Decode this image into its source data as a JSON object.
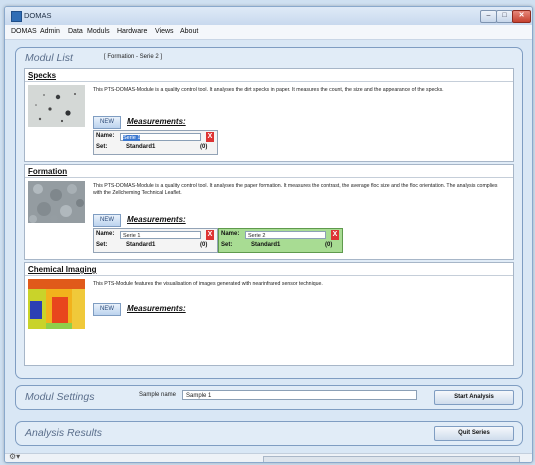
{
  "window": {
    "title": "DOMAS",
    "min_glyph": "–",
    "max_glyph": "□",
    "close_glyph": "✕"
  },
  "menu": [
    "DOMAS",
    "Admin",
    "Data",
    "Moduls",
    "Hardware",
    "Views",
    "About"
  ],
  "modul_list": {
    "title": "Modul List",
    "selection": "[ Formation - Serie 2 ]",
    "sections": {
      "specks": {
        "title": "Specks",
        "description": "This PTS-DOMAS-Module is a quality control tool. It analyses the dirt specks in paper. It measures the count, the size and the appearance of the specks.",
        "new_label": "NEW",
        "measurements_label": "Measurements:",
        "sets": [
          {
            "name_label": "Name:",
            "name_value": "Serie 1",
            "set_label": "Set:",
            "set_value": "Standard1",
            "count": "(0)",
            "close": "X"
          }
        ]
      },
      "formation": {
        "title": "Formation",
        "description": "This PTS-DOMAS-Module is a quality control tool. It analyses the paper formation. It measures the contrast, the average floc size and the floc orientation. The analysis complies with the Zellcheming Technical Leaflet.",
        "new_label": "NEW",
        "measurements_label": "Measurements:",
        "sets": [
          {
            "name_label": "Name:",
            "name_value": "Serie 1",
            "set_label": "Set:",
            "set_value": "Standard1",
            "count": "(0)",
            "close": "X"
          },
          {
            "name_label": "Name:",
            "name_value": "Serie 2",
            "set_label": "Set:",
            "set_value": "Standard1",
            "count": "(0)",
            "close": "X"
          }
        ]
      },
      "chemical": {
        "title": "Chemical Imaging",
        "description": "This PTS-Module features the visualisation of images generated with nearinfrared sensor technique.",
        "new_label": "NEW",
        "measurements_label": "Measurements:"
      }
    }
  },
  "modul_settings": {
    "title": "Modul Settings",
    "sample_label": "Sample name",
    "sample_value": "Sample 1",
    "start_label": "Start Analysis"
  },
  "analysis_results": {
    "title": "Analysis Results",
    "quit_label": "Quit Series"
  },
  "status": {
    "gear_glyph": "⚙▾"
  },
  "colors": {
    "accent_blue": "#3b78d0",
    "close_red": "#d33333",
    "active_set_green": "#a8dc93"
  },
  "icons": {
    "app": "domas-app-icon",
    "gear": "gear-icon",
    "remove": "close-icon"
  }
}
